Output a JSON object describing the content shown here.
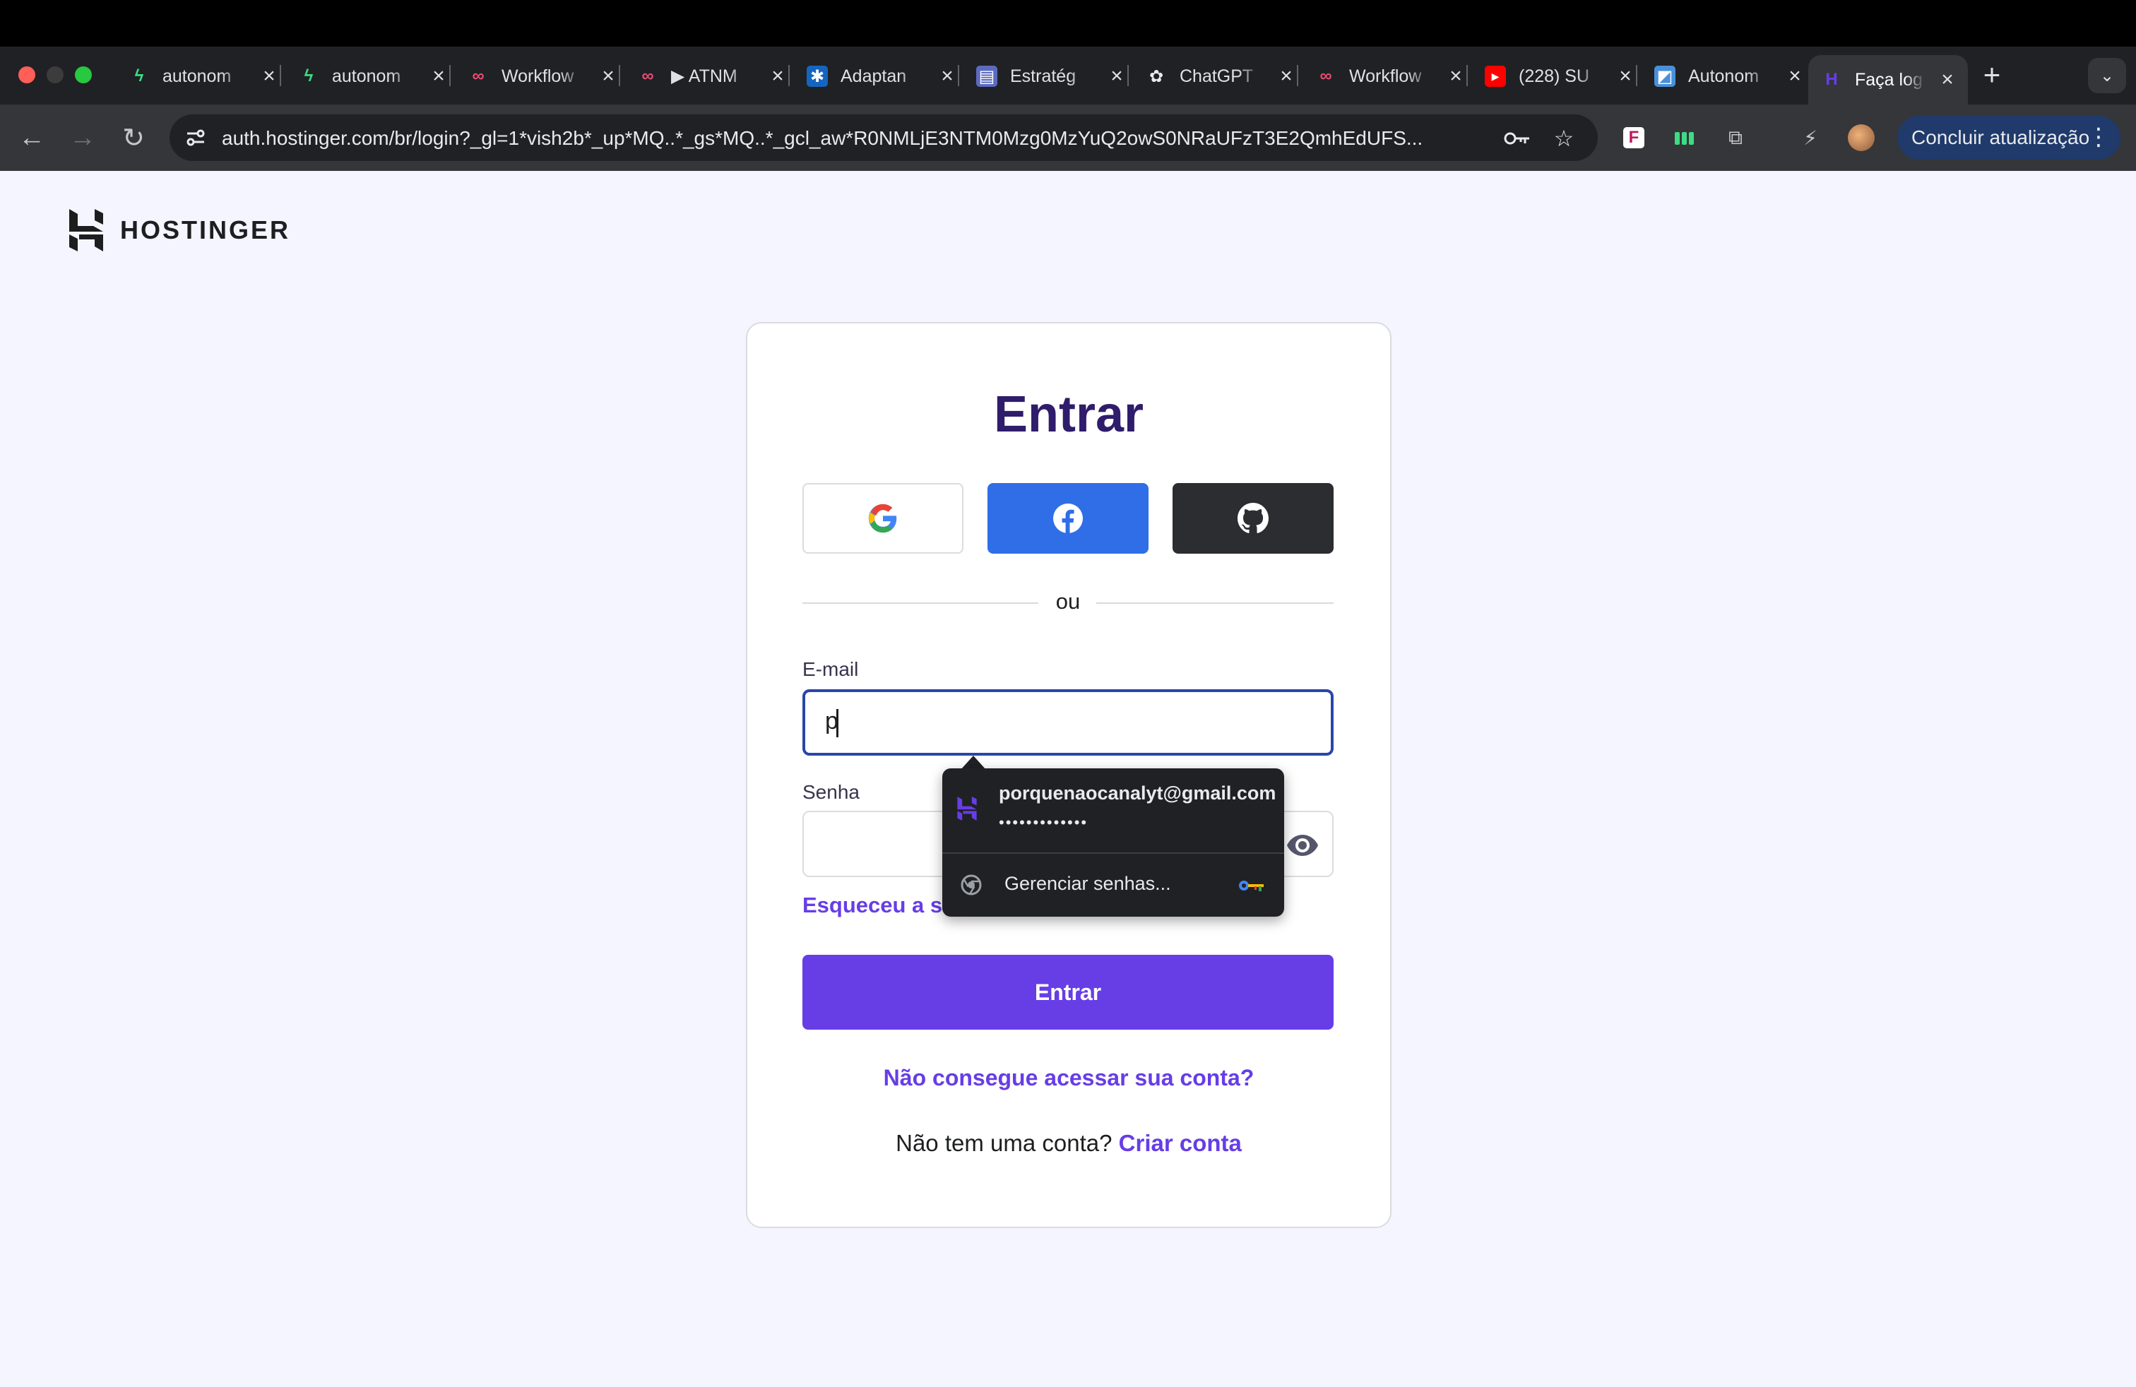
{
  "browser": {
    "tabs": [
      {
        "title": "autonom",
        "icon": "bolt-icon",
        "color": "#3ddc84"
      },
      {
        "title": "autonom",
        "icon": "bolt-icon",
        "color": "#3ddc84"
      },
      {
        "title": "Workflow",
        "icon": "workflow-icon",
        "color": "#ea4b71"
      },
      {
        "title": "▶ ATNM",
        "icon": "workflow-icon",
        "color": "#ea4b71"
      },
      {
        "title": "Adaptan",
        "icon": "butterfly-icon",
        "color": "#1565c0"
      },
      {
        "title": "Estratég",
        "icon": "printer-icon",
        "color": "#5c6bc0"
      },
      {
        "title": "ChatGPT",
        "icon": "openai-icon",
        "color": "#e8eaed"
      },
      {
        "title": "Workflow",
        "icon": "workflow-icon",
        "color": "#ea4b71"
      },
      {
        "title": "(228) SU",
        "icon": "youtube-icon",
        "color": "#ff0000"
      },
      {
        "title": "Autonom",
        "icon": "doc-icon",
        "color": "#4a90d9"
      },
      {
        "title": "Faça log",
        "icon": "hostinger-icon",
        "color": "#673de6",
        "active": true
      }
    ],
    "url": "auth.hostinger.com/br/login?_gl=1*vish2b*_up*MQ..*_gs*MQ..*_gcl_aw*R0NMLjE3NTM0Mzg0MzYuQ2owS0NRaUFzT3E2QmhEdUFS...",
    "update_button": "Concluir atualização"
  },
  "page": {
    "brand": "HOSTINGER",
    "title": "Entrar",
    "divider_text": "ou",
    "email_label": "E-mail",
    "email_value": "p",
    "password_label": "Senha",
    "forgot_link": "Esqueceu a s",
    "submit_button": "Entrar",
    "help_link": "Não consegue acessar sua conta?",
    "signup_text": "Não tem uma conta?",
    "signup_link": "Criar conta"
  },
  "autofill": {
    "email": "porquenaocanalyt@gmail.com",
    "password_mask": "•••••••••••••",
    "manage": "Gerenciar senhas..."
  },
  "colors": {
    "accent": "#673de6",
    "title": "#2f1c6a",
    "facebook": "#2f6ee6",
    "github": "#2b2d31"
  }
}
